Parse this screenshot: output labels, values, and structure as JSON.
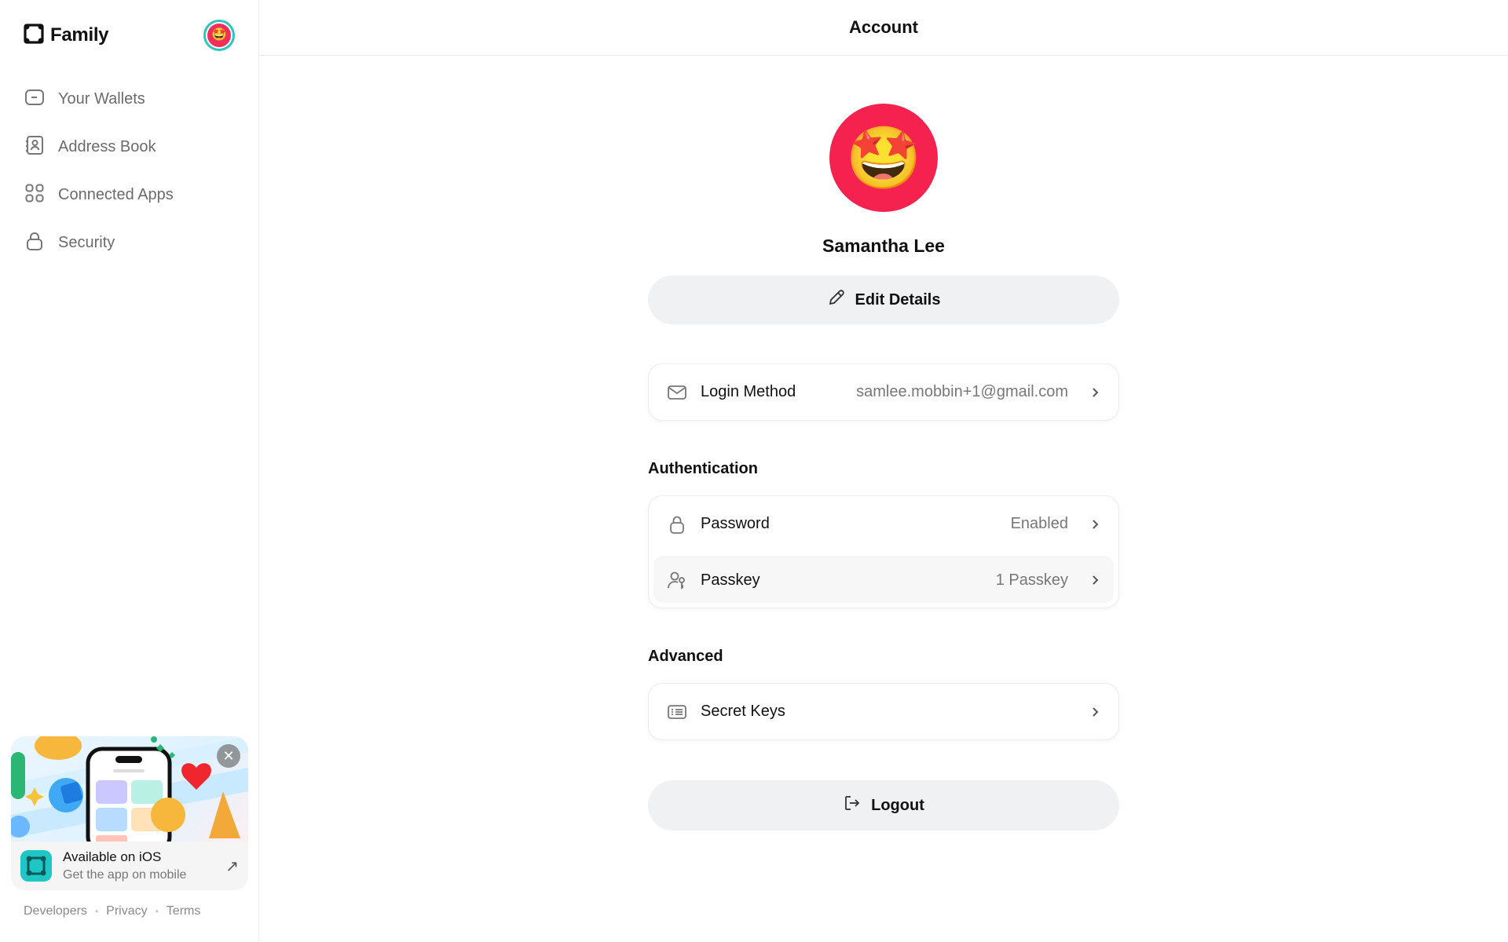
{
  "brand": {
    "name": "Family"
  },
  "sidebar": {
    "items": [
      {
        "label": "Your Wallets",
        "icon": "wallet-icon"
      },
      {
        "label": "Address Book",
        "icon": "contact-book-icon"
      },
      {
        "label": "Connected Apps",
        "icon": "apps-grid-icon"
      },
      {
        "label": "Security",
        "icon": "lock-icon"
      }
    ],
    "promo": {
      "title": "Available on iOS",
      "subtitle": "Get the app on mobile"
    },
    "footer": [
      "Developers",
      "Privacy",
      "Terms"
    ]
  },
  "header": {
    "title": "Account"
  },
  "profile": {
    "name": "Samantha Lee",
    "avatar_emoji": "🤩",
    "avatar_color": "#f5224f",
    "edit_label": "Edit Details"
  },
  "login": {
    "label": "Login Method",
    "value": "samlee.mobbin+1@gmail.com"
  },
  "authentication": {
    "title": "Authentication",
    "rows": [
      {
        "label": "Password",
        "value": "Enabled",
        "icon": "lock-icon"
      },
      {
        "label": "Passkey",
        "value": "1 Passkey",
        "icon": "passkey-icon"
      }
    ]
  },
  "advanced": {
    "title": "Advanced",
    "rows": [
      {
        "label": "Secret Keys",
        "icon": "keys-list-icon"
      }
    ]
  },
  "logout": {
    "label": "Logout"
  },
  "colors": {
    "accent_teal": "#2ec4c0",
    "avatar_red": "#f5224f",
    "button_bg": "#f0f1f2"
  }
}
